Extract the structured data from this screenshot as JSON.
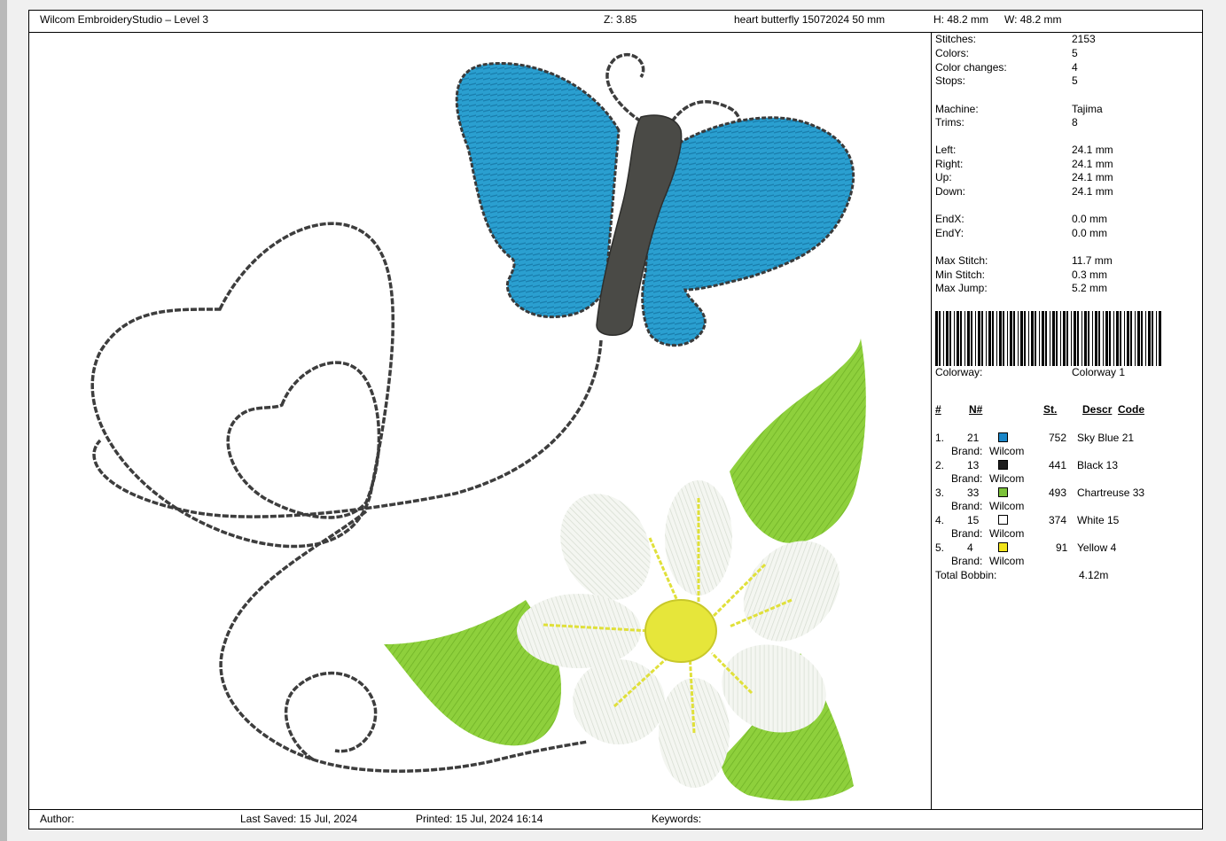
{
  "header": {
    "app_title": "Wilcom EmbroideryStudio – Level 3",
    "zoom": "Z: 3.85",
    "design_name": "heart butterfly 15072024 50 mm",
    "height": "H: 48.2 mm",
    "width": "W: 48.2 mm"
  },
  "stats": [
    {
      "label": "Stitches:",
      "value": "2153"
    },
    {
      "label": "Colors:",
      "value": "5"
    },
    {
      "label": "Color changes:",
      "value": "4"
    },
    {
      "label": "Stops:",
      "value": "5"
    },
    {
      "label": "Machine:",
      "value": "Tajima"
    },
    {
      "label": "Trims:",
      "value": "8"
    },
    {
      "label": "Left:",
      "value": "24.1 mm"
    },
    {
      "label": "Right:",
      "value": "24.1 mm"
    },
    {
      "label": "Up:",
      "value": "24.1 mm"
    },
    {
      "label": "Down:",
      "value": "24.1 mm"
    },
    {
      "label": "EndX:",
      "value": "0.0 mm"
    },
    {
      "label": "EndY:",
      "value": "0.0 mm"
    },
    {
      "label": "Max Stitch:",
      "value": "11.7 mm"
    },
    {
      "label": "Min Stitch:",
      "value": "0.3 mm"
    },
    {
      "label": "Max Jump:",
      "value": "5.2 mm"
    }
  ],
  "colorway": {
    "label": "Colorway:",
    "value": "Colorway 1"
  },
  "color_table": {
    "headers": {
      "index": "#",
      "number": "N#",
      "stitches": "St.",
      "descr": "Descr",
      "code": "Code"
    },
    "brand_prefix": "Brand:",
    "rows": [
      {
        "index": "1.",
        "number": "21",
        "color": "#1a86c8",
        "stitches": "752",
        "descr": "Sky Blue 21",
        "brand": "Wilcom"
      },
      {
        "index": "2.",
        "number": "13",
        "color": "#1c1c1c",
        "stitches": "441",
        "descr": "Black 13",
        "brand": "Wilcom"
      },
      {
        "index": "3.",
        "number": "33",
        "color": "#7cc23a",
        "stitches": "493",
        "descr": "Chartreuse 33",
        "brand": "Wilcom"
      },
      {
        "index": "4.",
        "number": "15",
        "color": "#ffffff",
        "stitches": "374",
        "descr": "White 15",
        "brand": "Wilcom"
      },
      {
        "index": "5.",
        "number": "4",
        "color": "#f2e41a",
        "stitches": "91",
        "descr": "Yellow 4",
        "brand": "Wilcom"
      }
    ],
    "total_bobbin_label": "Total Bobbin:",
    "total_bobbin_value": "4.12m"
  },
  "footer": {
    "author": "Author:",
    "last_saved": "Last Saved: 15 Jul, 2024",
    "printed": "Printed: 15 Jul, 2024 16:14",
    "keywords": "Keywords:"
  },
  "design_colors": {
    "wing_blue": "#2a9fd0",
    "wing_outline": "#3a3a3a",
    "body": "#4a4a46",
    "leaf_green": "#8ed03c",
    "petal_white": "#f2f4ef",
    "center_yellow": "#e6e63a"
  }
}
